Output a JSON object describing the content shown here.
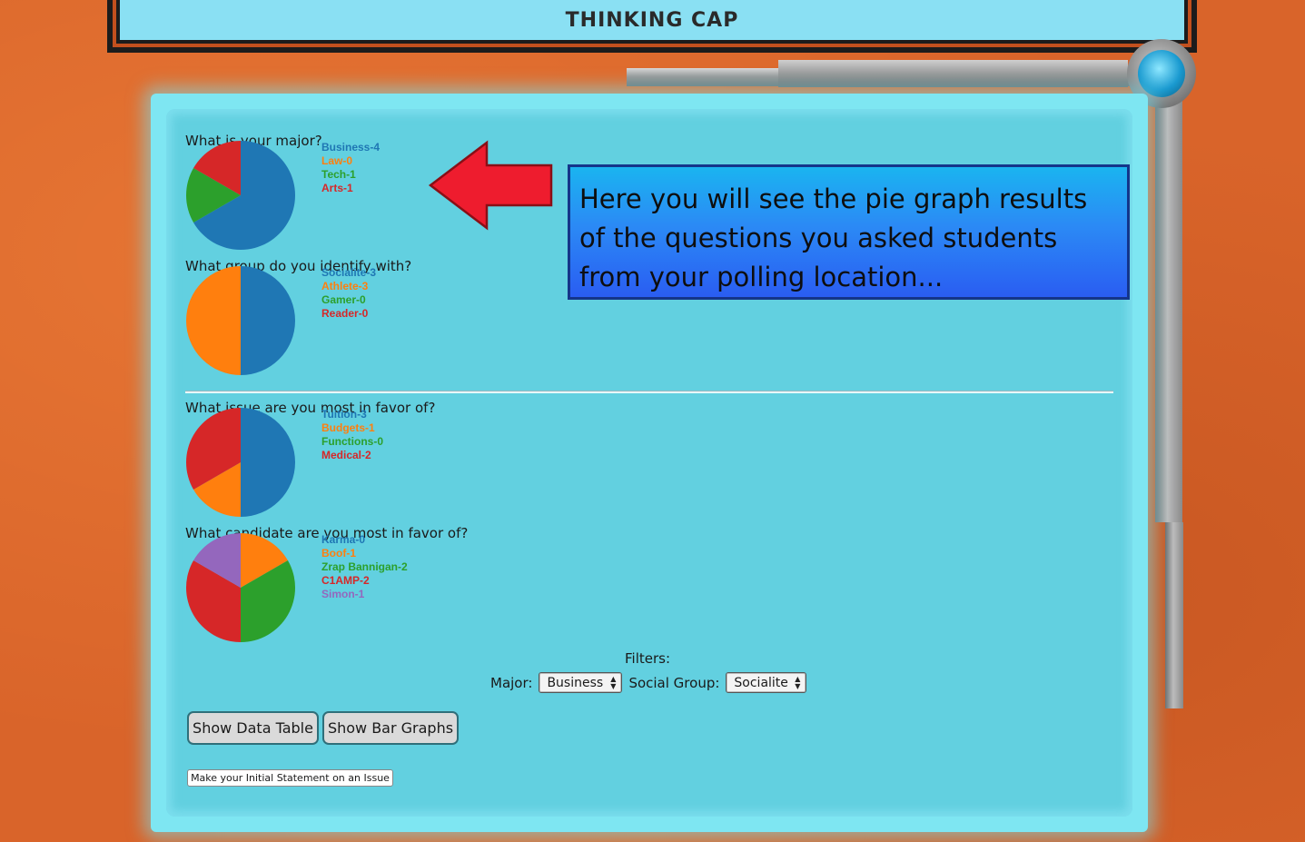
{
  "header": {
    "title": "THINKING CAP"
  },
  "callout": {
    "text": "Here you will see the pie graph results of the questions you asked students from your polling location..."
  },
  "questions": [
    {
      "title": "What is your major?",
      "legend": [
        "Business-4",
        "Law-0",
        "Tech-1",
        "Arts-1"
      ]
    },
    {
      "title": "What group do you identify with?",
      "legend": [
        "Socialite-3",
        "Athlete-3",
        "Gamer-0",
        "Reader-0"
      ]
    },
    {
      "title": "What issue are you most in favor of?",
      "legend": [
        "Tuition-3",
        "Budgets-1",
        "Functions-0",
        "Medical-2"
      ]
    },
    {
      "title": "What candidate are you most in favor of?",
      "legend": [
        "Karma-0",
        "Boof-1",
        "Zrap Bannigan-2",
        "C1AMP-2",
        "Simon-1"
      ]
    }
  ],
  "chart_data": [
    {
      "type": "pie",
      "title": "What is your major?",
      "categories": [
        "Business",
        "Law",
        "Tech",
        "Arts"
      ],
      "values": [
        4,
        0,
        1,
        1
      ]
    },
    {
      "type": "pie",
      "title": "What group do you identify with?",
      "categories": [
        "Socialite",
        "Athlete",
        "Gamer",
        "Reader"
      ],
      "values": [
        3,
        3,
        0,
        0
      ]
    },
    {
      "type": "pie",
      "title": "What issue are you most in favor of?",
      "categories": [
        "Tuition",
        "Budgets",
        "Functions",
        "Medical"
      ],
      "values": [
        3,
        1,
        0,
        2
      ]
    },
    {
      "type": "pie",
      "title": "What candidate are you most in favor of?",
      "categories": [
        "Karma",
        "Boof",
        "Zrap Bannigan",
        "C1AMP",
        "Simon"
      ],
      "values": [
        0,
        1,
        2,
        2,
        1
      ]
    }
  ],
  "colors": [
    "#1f77b4",
    "#ff7f0e",
    "#2ca02c",
    "#d62728",
    "#9467bd"
  ],
  "filters": {
    "label": "Filters:",
    "major_label": "Major:",
    "major_value": "Business",
    "social_label": "Social Group:",
    "social_value": "Socialite"
  },
  "buttons": {
    "data_table": "Show Data Table",
    "bar_graphs": "Show Bar Graphs",
    "initial_statement": "Make your Initial Statement on an Issue"
  }
}
